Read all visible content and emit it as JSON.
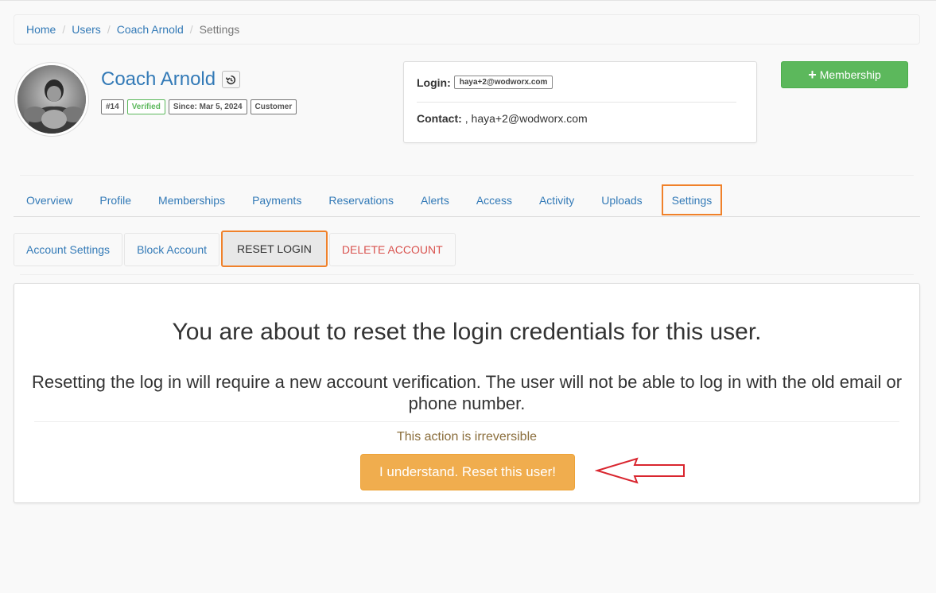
{
  "breadcrumb": {
    "items": [
      "Home",
      "Users",
      "Coach Arnold"
    ],
    "current": "Settings",
    "separator": "/"
  },
  "user": {
    "name": "Coach Arnold",
    "badges": {
      "id": "#14",
      "verified": "Verified",
      "since": "Since: Mar 5, 2024",
      "role": "Customer"
    }
  },
  "info": {
    "login_label": "Login:",
    "login_value": "haya+2@wodworx.com",
    "contact_label": "Contact:",
    "contact_value": ", haya+2@wodworx.com"
  },
  "actions": {
    "membership_label": "Membership"
  },
  "main_tabs": [
    "Overview",
    "Profile",
    "Memberships",
    "Payments",
    "Reservations",
    "Alerts",
    "Access",
    "Activity",
    "Uploads",
    "Settings"
  ],
  "main_tab_active": "Settings",
  "sub_tabs": [
    "Account Settings",
    "Block Account",
    "RESET LOGIN",
    "DELETE ACCOUNT"
  ],
  "sub_tab_active": "RESET LOGIN",
  "panel": {
    "heading": "You are about to reset the login credentials for this user.",
    "description": "Resetting the log in will require a new account verification. The user will not be able to log in with the old email or phone number.",
    "warning": "This action is irreversible",
    "confirm_label": "I understand. Reset this user!"
  },
  "colors": {
    "link": "#337ab7",
    "success": "#5cb85c",
    "warning": "#f0ad4e",
    "danger": "#d9534f",
    "highlight": "#f0812a",
    "annotation_arrow": "#d9262f"
  },
  "icons": {
    "history": "history-icon",
    "plus": "plus-icon",
    "arrow": "left-arrow-annotation"
  }
}
